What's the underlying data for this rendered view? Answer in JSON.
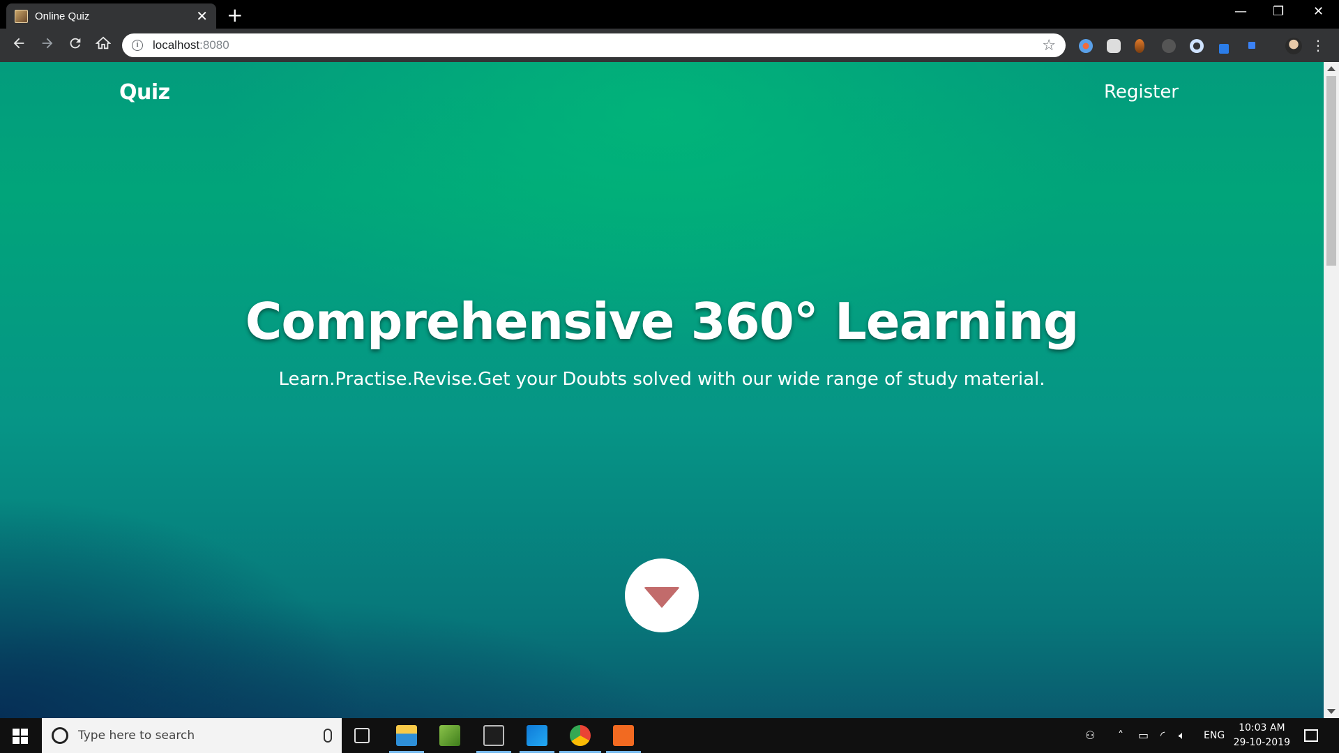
{
  "browser": {
    "tab_title": "Online Quiz",
    "tab_close": "✕",
    "new_tab": "+",
    "url_host": "localhost",
    "url_port": ":8080",
    "win_minimize": "—",
    "win_restore": "❐",
    "win_close": "✕"
  },
  "page": {
    "brand": "Quiz",
    "register_label": "Register",
    "hero_title": "Comprehensive 360° Learning",
    "hero_subtitle": "Learn.Practise.Revise.Get your Doubts solved with our wide range of study material.",
    "accent_color": "#c26b6b"
  },
  "taskbar": {
    "search_placeholder": "Type here to search",
    "language": "ENG",
    "time": "10:03 AM",
    "date": "29-10-2019"
  },
  "icons": {
    "back": "back-arrow-icon",
    "forward": "forward-arrow-icon",
    "reload": "reload-icon",
    "home": "home-icon",
    "star": "bookmark-star-icon",
    "menu": "kebab-menu-icon"
  }
}
